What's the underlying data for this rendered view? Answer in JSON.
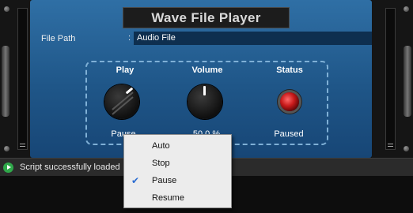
{
  "header": {
    "title": "Wave File Player"
  },
  "file_path": {
    "label": "File Path",
    "separator": ":",
    "value": "Audio File"
  },
  "controls": {
    "play": {
      "label": "Play",
      "value": "Pause"
    },
    "volume": {
      "label": "Volume",
      "value": "50.0 %"
    },
    "status": {
      "label": "Status",
      "value": "Paused",
      "led_color": "#c81a1a"
    }
  },
  "statusbar": {
    "message": "Script successfully loaded"
  },
  "context_menu": {
    "items": [
      {
        "label": "Auto",
        "checked": false
      },
      {
        "label": "Stop",
        "checked": false
      },
      {
        "label": "Pause",
        "checked": true
      },
      {
        "label": "Resume",
        "checked": false
      }
    ],
    "check_glyph": "✔"
  },
  "colors": {
    "panel": "#1f5688",
    "accent": "#2a6bd1",
    "ok_icon": "#2fa84a"
  }
}
